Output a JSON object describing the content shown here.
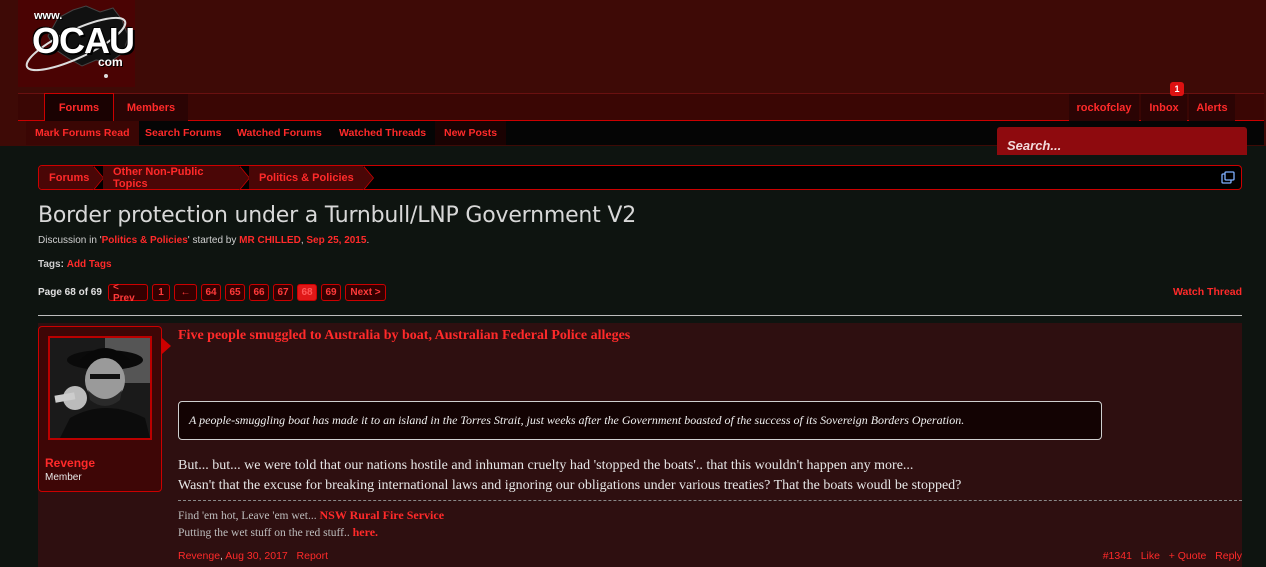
{
  "header": {
    "logo": {
      "www": "www.",
      "main": "OCAU",
      "com": "com"
    }
  },
  "nav": {
    "tabs": [
      "Forums",
      "Members"
    ],
    "user": "rockofclay",
    "inbox_label": "Inbox",
    "inbox_count": "1",
    "alerts_label": "Alerts"
  },
  "subnav": {
    "items": [
      "Mark Forums Read",
      "Search Forums",
      "Watched Forums",
      "Watched Threads",
      "New Posts"
    ]
  },
  "search": {
    "placeholder": "Search..."
  },
  "breadcrumb": [
    "Forums",
    "Other Non-Public Topics",
    "Politics & Policies"
  ],
  "thread": {
    "title": "Border protection under a Turnbull/LNP Government V2",
    "meta_prefix": "Discussion in '",
    "meta_forum": "Politics & Policies",
    "meta_mid": "' started by ",
    "meta_author": "MR CHILLED",
    "meta_sep": ", ",
    "meta_date": "Sep 25, 2015",
    "meta_end": ".",
    "tags_label": "Tags:",
    "tags_add": "Add Tags",
    "watch": "Watch Thread"
  },
  "pagination": {
    "label": "Page 68 of 69",
    "prev": "< Prev",
    "first": "1",
    "jump": "←",
    "pages": [
      "64",
      "65",
      "66",
      "67",
      "68",
      "69"
    ],
    "current": "68",
    "next": "Next >"
  },
  "post": {
    "username": "Revenge",
    "user_title": "Member",
    "link_title": "Five people smuggled to Australia by boat, Australian Federal Police alleges",
    "quote": "A people-smuggling boat has made it to an island in the Torres Strait, just weeks after the Government boasted of the success of its Sovereign Borders Operation.",
    "body_line1": "But... but... we were told that our nations hostile and inhuman cruelty had 'stopped the boats'.. that this wouldn't happen any more...",
    "body_line2": "Wasn't that the excuse for breaking international laws and ignoring our obligations under various treaties? That the boats woudl be stopped?",
    "sig_line1_prefix": "Find 'em hot, Leave 'em wet... ",
    "sig_line1_link": "NSW Rural Fire Service",
    "sig_line2_prefix": "Putting the wet stuff on the red stuff.. ",
    "sig_line2_link": "here.",
    "footer_author": "Revenge",
    "footer_date": "Aug 30, 2017",
    "footer_report": "Report",
    "post_number": "#1341",
    "like": "Like",
    "quote_btn": "+ Quote",
    "reply": "Reply"
  },
  "colors": {
    "accent": "#ff2a2a",
    "header_bg": "#3e0a06",
    "page_bg": "#0e1410",
    "post_bg": "#2e0f10"
  }
}
